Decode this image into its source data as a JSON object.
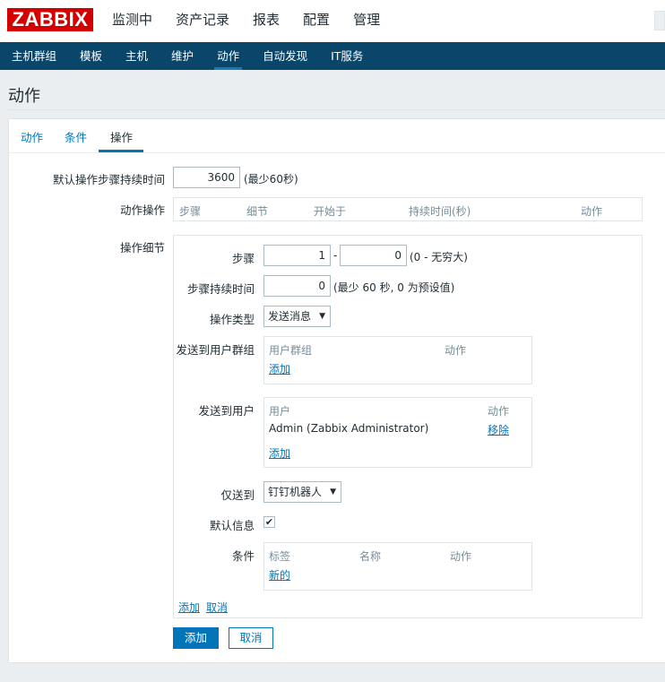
{
  "logo": {
    "text": "ZABBIX"
  },
  "main_nav": [
    {
      "label": "监测中"
    },
    {
      "label": "资产记录"
    },
    {
      "label": "报表"
    },
    {
      "label": "配置"
    },
    {
      "label": "管理"
    }
  ],
  "sub_nav": [
    {
      "label": "主机群组"
    },
    {
      "label": "模板"
    },
    {
      "label": "主机"
    },
    {
      "label": "维护"
    },
    {
      "label": "动作"
    },
    {
      "label": "自动发现"
    },
    {
      "label": "IT服务"
    }
  ],
  "page_title": "动作",
  "tabs": [
    {
      "label": "动作"
    },
    {
      "label": "条件"
    },
    {
      "label": "操作"
    }
  ],
  "form": {
    "default_step_duration_label": "默认操作步骤持续时间",
    "default_step_duration_value": "3600",
    "default_step_duration_hint": "(最少60秒)",
    "operations_label": "动作操作",
    "operations_columns": [
      "步骤",
      "细节",
      "开始于",
      "持续时间(秒)",
      "动作"
    ],
    "details_label": "操作细节",
    "details": {
      "steps_label": "步骤",
      "step_from": "1",
      "step_sep": "-",
      "step_to": "0",
      "step_hint": "(0 - 无穷大)",
      "step_duration_label": "步骤持续时间",
      "step_duration_value": "0",
      "step_duration_hint": "(最少 60 秒, 0 为预设值)",
      "op_type_label": "操作类型",
      "op_type_value": "发送消息",
      "send_groups_label": "发送到用户群组",
      "groups_col_group": "用户群组",
      "groups_col_action": "动作",
      "groups_add": "添加",
      "send_users_label": "发送到用户",
      "users_col_user": "用户",
      "users_col_action": "动作",
      "user_name": "Admin (Zabbix Administrator)",
      "user_remove": "移除",
      "users_add": "添加",
      "send_only_label": "仅送到",
      "send_only_value": "钉钉机器人",
      "default_msg_label": "默认信息",
      "default_msg_checked": "✔",
      "conditions_label": "条件",
      "cond_col_label": "标签",
      "cond_col_name": "名称",
      "cond_col_action": "动作",
      "cond_new": "新的",
      "add_link": "添加",
      "cancel_link": "取消"
    }
  },
  "buttons": {
    "add": "添加",
    "cancel": "取消"
  }
}
